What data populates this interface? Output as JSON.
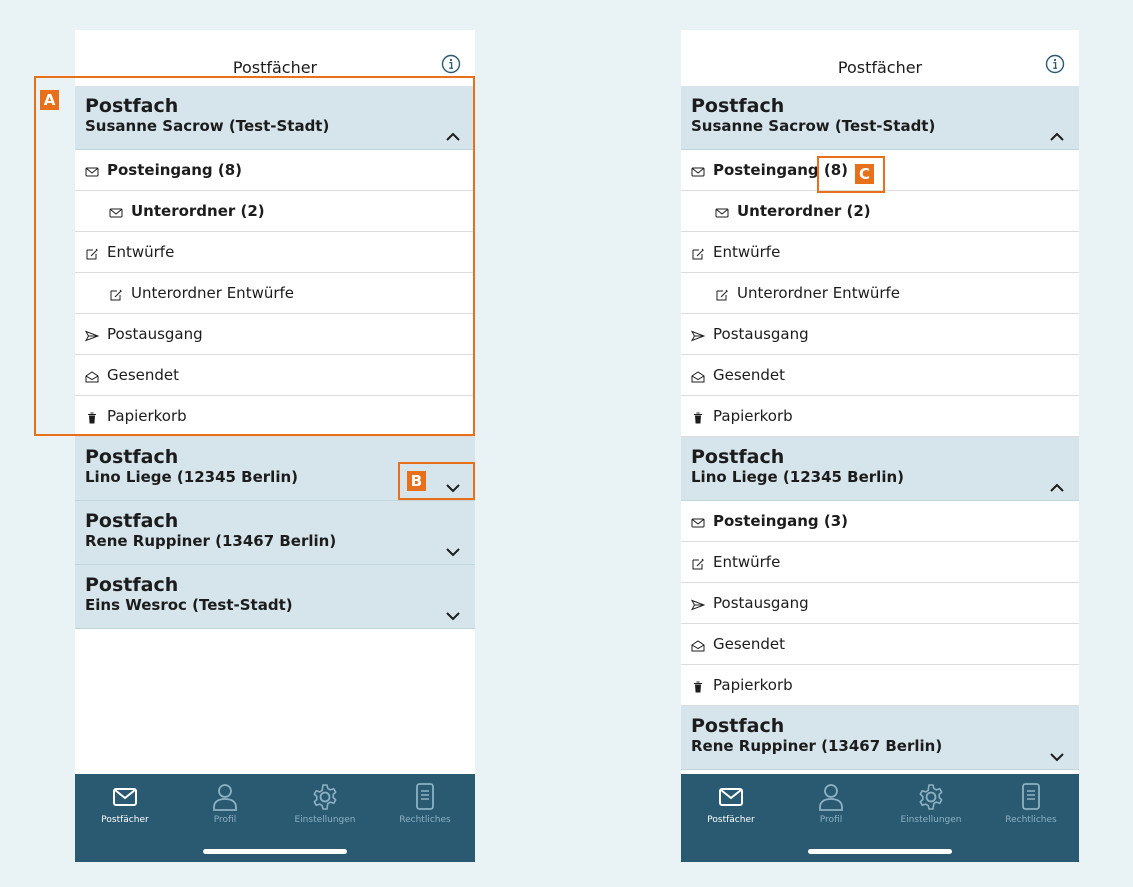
{
  "colors": {
    "background": "#e9f2f5",
    "header_bg": "#d6e5ec",
    "tabbar_bg": "#295a72",
    "callout": "#e8701a",
    "tab_inactive": "#8db1c2"
  },
  "left": {
    "title": "Postfächer",
    "sections": [
      {
        "kind": "Postfach",
        "name": "Susanne Sacrow (Test-Stadt)",
        "expanded": true,
        "folders": [
          {
            "label": "Posteingang (8)",
            "icon": "envelope-icon",
            "bold": true,
            "sub": false
          },
          {
            "label": "Unterordner (2)",
            "icon": "envelope-icon",
            "bold": true,
            "sub": true
          },
          {
            "label": "Entwürfe",
            "icon": "draft-icon",
            "bold": false,
            "sub": false
          },
          {
            "label": "Unterordner Entwürfe",
            "icon": "draft-icon",
            "bold": false,
            "sub": true
          },
          {
            "label": "Postausgang",
            "icon": "send-icon",
            "bold": false,
            "sub": false
          },
          {
            "label": "Gesendet",
            "icon": "open-envelope-icon",
            "bold": false,
            "sub": false
          },
          {
            "label": "Papierkorb",
            "icon": "trash-icon",
            "bold": false,
            "sub": false
          }
        ]
      },
      {
        "kind": "Postfach",
        "name": "Lino Liege (12345 Berlin)",
        "expanded": false
      },
      {
        "kind": "Postfach",
        "name": "Rene Ruppiner (13467 Berlin)",
        "expanded": false
      },
      {
        "kind": "Postfach",
        "name": "Eins Wesroc (Test-Stadt)",
        "expanded": false
      }
    ]
  },
  "right": {
    "title": "Postfächer",
    "sections": [
      {
        "kind": "Postfach",
        "name": "Susanne Sacrow (Test-Stadt)",
        "expanded": true,
        "folders": [
          {
            "label": "Posteingang (8)",
            "icon": "envelope-icon",
            "bold": true,
            "sub": false
          },
          {
            "label": "Unterordner (2)",
            "icon": "envelope-icon",
            "bold": true,
            "sub": true
          },
          {
            "label": "Entwürfe",
            "icon": "draft-icon",
            "bold": false,
            "sub": false
          },
          {
            "label": "Unterordner Entwürfe",
            "icon": "draft-icon",
            "bold": false,
            "sub": true
          },
          {
            "label": "Postausgang",
            "icon": "send-icon",
            "bold": false,
            "sub": false
          },
          {
            "label": "Gesendet",
            "icon": "open-envelope-icon",
            "bold": false,
            "sub": false
          },
          {
            "label": "Papierkorb",
            "icon": "trash-icon",
            "bold": false,
            "sub": false
          }
        ]
      },
      {
        "kind": "Postfach",
        "name": "Lino Liege (12345 Berlin)",
        "expanded": true,
        "folders": [
          {
            "label": "Posteingang (3)",
            "icon": "envelope-icon",
            "bold": true,
            "sub": false
          },
          {
            "label": "Entwürfe",
            "icon": "draft-icon",
            "bold": false,
            "sub": false
          },
          {
            "label": "Postausgang",
            "icon": "send-icon",
            "bold": false,
            "sub": false
          },
          {
            "label": "Gesendet",
            "icon": "open-envelope-icon",
            "bold": false,
            "sub": false
          },
          {
            "label": "Papierkorb",
            "icon": "trash-icon",
            "bold": false,
            "sub": false
          }
        ]
      },
      {
        "kind": "Postfach",
        "name": "Rene Ruppiner (13467 Berlin)",
        "expanded": false
      }
    ]
  },
  "tabs": [
    {
      "label": "Postfächer",
      "icon": "mailbox-icon",
      "active": true
    },
    {
      "label": "Profil",
      "icon": "profile-icon",
      "active": false
    },
    {
      "label": "Einstellungen",
      "icon": "settings-icon",
      "active": false
    },
    {
      "label": "Rechtliches",
      "icon": "legal-icon",
      "active": false
    }
  ],
  "callouts": {
    "a": "A",
    "b": "B",
    "c": "C"
  }
}
